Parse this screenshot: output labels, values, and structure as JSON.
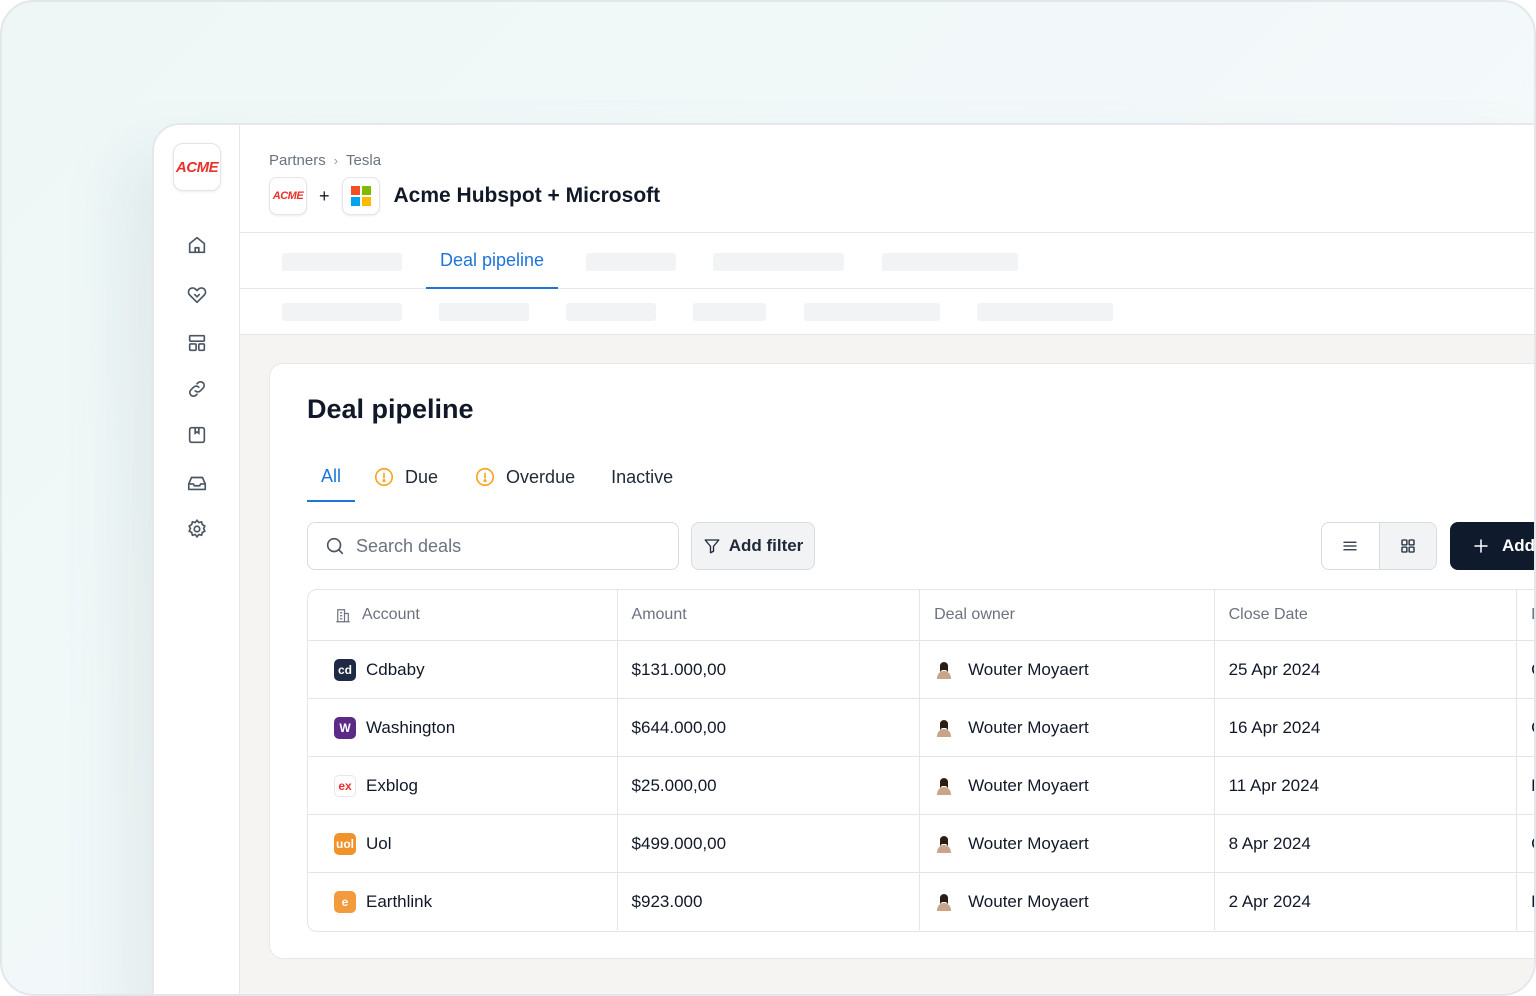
{
  "sidebar": {
    "logo": "ACME",
    "nav": [
      "home-icon",
      "handshake-icon",
      "layout-icon",
      "link-icon",
      "bookmark-icon",
      "inbox-icon",
      "gear-icon"
    ]
  },
  "header": {
    "breadcrumb": [
      "Partners",
      "Tesla"
    ],
    "logo_left": "ACME",
    "plus": "+",
    "title": "Acme Hubspot + Microsoft"
  },
  "tabs": {
    "active": "Deal pipeline"
  },
  "card": {
    "title": "Deal pipeline",
    "filters": [
      "All",
      "Due",
      "Overdue",
      "Inactive"
    ],
    "search_placeholder": "Search deals",
    "add_filter": "Add filter",
    "add": "Add"
  },
  "table": {
    "columns": [
      "Account",
      "Amount",
      "Deal owner",
      "Close Date",
      "D"
    ],
    "rows": [
      {
        "account": "Cdbaby",
        "amount": "$131.000,00",
        "owner": "Wouter Moyaert",
        "close": "25 Apr 2024",
        "extra": "C",
        "logo_color": "#1f2a44",
        "logo_text": "cd"
      },
      {
        "account": "Washington",
        "amount": "$644.000,00",
        "owner": "Wouter Moyaert",
        "close": "16 Apr 2024",
        "extra": "C",
        "logo_color": "#5b2a86",
        "logo_text": "W"
      },
      {
        "account": "Exblog",
        "amount": "$25.000,00",
        "owner": "Wouter Moyaert",
        "close": "11 Apr 2024",
        "extra": "F",
        "logo_color": "#ffffff",
        "logo_text": "ex"
      },
      {
        "account": "Uol",
        "amount": "$499.000,00",
        "owner": "Wouter Moyaert",
        "close": "8 Apr 2024",
        "extra": "C",
        "logo_color": "#f0932b",
        "logo_text": "uol"
      },
      {
        "account": "Earthlink",
        "amount": "$923.000",
        "owner": "Wouter Moyaert",
        "close": "2 Apr 2024",
        "extra": "D",
        "logo_color": "#f39b3c",
        "logo_text": "e"
      }
    ]
  },
  "colors": {
    "accent": "#1e74d8",
    "primary_button": "#0f1b2d",
    "acme_red": "#e8322b",
    "warning": "#f5a623"
  }
}
